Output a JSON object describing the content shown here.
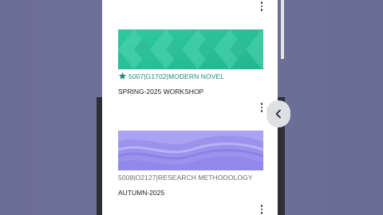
{
  "courses": [
    {
      "code": "5007|G1702|MODERN NOVEL",
      "term": "SPRING-2025 WORKSHOP",
      "starred": true,
      "banner_color": "#2bc49a",
      "banner_style": "diamond-pattern"
    },
    {
      "code": "5008|O2127|RESEARCH METHODOLOGY",
      "term": "AUTUMN-2025",
      "starred": false,
      "banner_color": "#9a93ee",
      "banner_style": "wave-pattern"
    }
  ],
  "icons": {
    "menu": "more-vert-icon",
    "star": "star-icon",
    "side_button": "chevron-left-icon"
  },
  "colors": {
    "background": "#6b6e97",
    "accent_teal": "#1f8a72",
    "card": "#ffffff"
  }
}
